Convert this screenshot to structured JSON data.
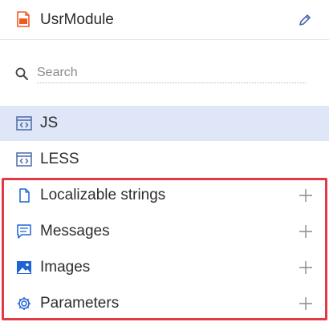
{
  "header": {
    "title": "UsrModule",
    "file_icon": "js-file-icon",
    "edit_icon": "pencil-icon"
  },
  "search": {
    "placeholder": "Search",
    "value": "",
    "icon": "search-icon"
  },
  "items": [
    {
      "label": "JS",
      "icon": "code-window-icon",
      "active": true
    },
    {
      "label": "LESS",
      "icon": "code-window-icon",
      "active": false
    },
    {
      "label": "Localizable strings",
      "icon": "document-icon",
      "has_add": true
    },
    {
      "label": "Messages",
      "icon": "message-icon",
      "has_add": true
    },
    {
      "label": "Images",
      "icon": "image-icon",
      "has_add": true
    },
    {
      "label": "Parameters",
      "icon": "gear-icon",
      "has_add": true
    }
  ],
  "colors": {
    "accent": "#1f63d6",
    "active_bg": "#dfe6f7",
    "highlight": "#e03a44",
    "js_orange": "#f05a22"
  }
}
